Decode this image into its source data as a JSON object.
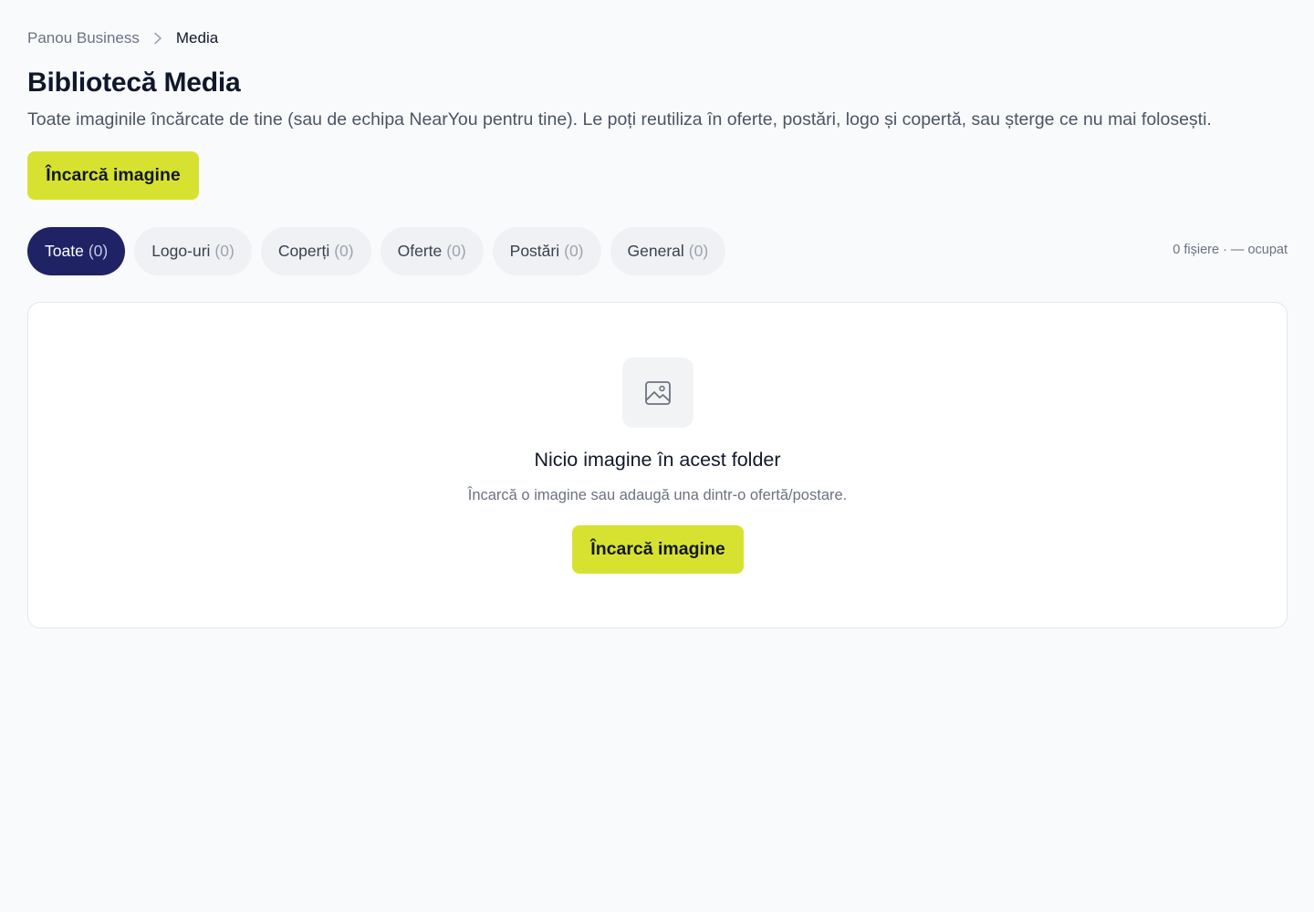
{
  "breadcrumb": {
    "parent": "Panou Business",
    "current": "Media"
  },
  "header": {
    "title": "Bibliotecă Media",
    "description": "Toate imaginile încărcate de tine (sau de echipa NearYou pentru tine). Le poți reutiliza în oferte, postări, logo și copertă, sau șterge ce nu mai folosești.",
    "upload_label": "Încarcă imagine"
  },
  "tabs": [
    {
      "label": "Toate",
      "count": "(0)",
      "active": true
    },
    {
      "label": "Logo-uri",
      "count": "(0)",
      "active": false
    },
    {
      "label": "Coperți",
      "count": "(0)",
      "active": false
    },
    {
      "label": "Oferte",
      "count": "(0)",
      "active": false
    },
    {
      "label": "Postări",
      "count": "(0)",
      "active": false
    },
    {
      "label": "General",
      "count": "(0)",
      "active": false
    }
  ],
  "storage": {
    "text": "0 fișiere · — ocupat"
  },
  "empty_state": {
    "icon": "image-icon",
    "title": "Nicio imagine în acest folder",
    "subtitle": "Încarcă o imagine sau adaugă una dintr-o ofertă/postare.",
    "upload_label": "Încarcă imagine"
  },
  "colors": {
    "accent": "#d7e230",
    "active_tab": "#1f2366",
    "background": "#f9fafc"
  }
}
